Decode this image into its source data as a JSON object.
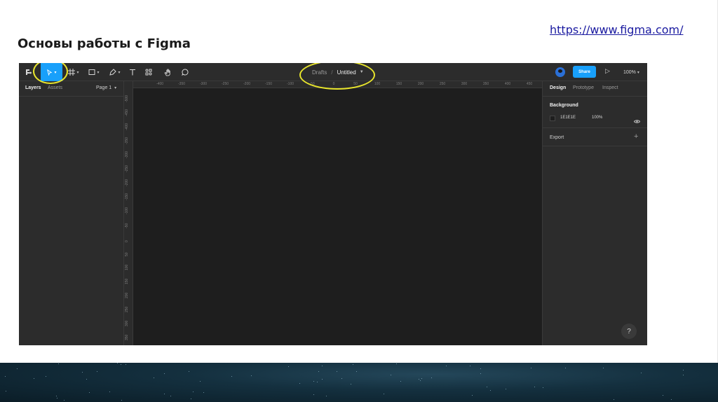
{
  "slide": {
    "title": "Основы работы с Figma",
    "link": "https://www.figma.com/"
  },
  "toolbar": {
    "icons": [
      "main-menu-icon",
      "move-tool-icon",
      "frame-tool-icon",
      "rectangle-tool-icon",
      "pen-tool-icon",
      "text-tool-icon",
      "resources-icon",
      "hand-tool-icon",
      "comment-icon"
    ],
    "breadcrumb": {
      "project": "Drafts",
      "separator": "/",
      "file": "Untitled"
    },
    "share_label": "Share",
    "zoom": "100%"
  },
  "left_panel": {
    "tabs": [
      "Layers",
      "Assets"
    ],
    "active_tab": "Layers",
    "page": "Page 1"
  },
  "ruler_h": [
    "-400",
    "-350",
    "-300",
    "-250",
    "-200",
    "-150",
    "-100",
    "-50",
    "0",
    "50",
    "100",
    "150",
    "200",
    "250",
    "300",
    "350",
    "400",
    "450"
  ],
  "ruler_v": [
    "-500",
    "-450",
    "-400",
    "-350",
    "-300",
    "-250",
    "-200",
    "-150",
    "-100",
    "-50",
    "0",
    "50",
    "100",
    "150",
    "200",
    "250",
    "300",
    "350",
    "400"
  ],
  "right_panel": {
    "tabs": [
      "Design",
      "Prototype",
      "Inspect"
    ],
    "active_tab": "Design",
    "background_label": "Background",
    "background_hex": "1E1E1E",
    "background_opacity": "100%",
    "export_label": "Export"
  },
  "help_label": "?",
  "colors": {
    "accent": "#18a0fb",
    "highlight": "#e8e52c",
    "canvas": "#1e1e1e",
    "panel": "#2c2c2c"
  }
}
